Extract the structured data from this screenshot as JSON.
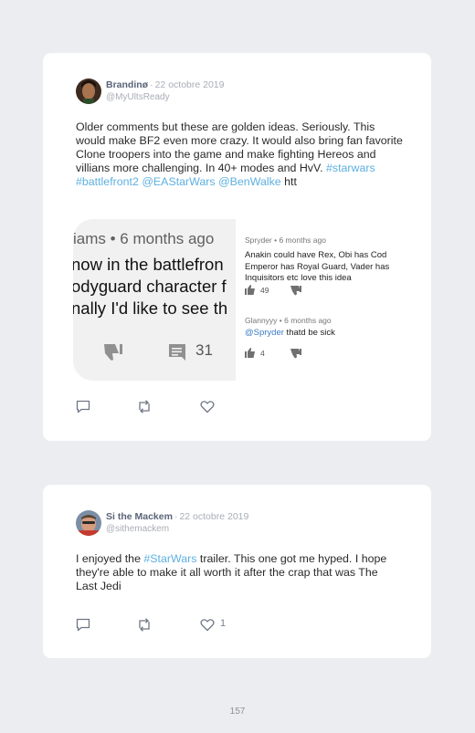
{
  "tweets": [
    {
      "name": "Brandinø",
      "separator": "·",
      "date": "22 octobre 2019",
      "handle": "@MyUltsReady",
      "body": [
        {
          "t": "text",
          "v": "Older comments but these are golden ideas. Seriously. This would make BF2 even more crazy. It would also bring fan favorite Clone troopers into the game and make fighting Hereos and villians more challenging. In 40+ modes and HvV. "
        },
        {
          "t": "tag",
          "v": "#starwars"
        },
        {
          "t": "text",
          "v": " "
        },
        {
          "t": "tag",
          "v": "#battlefront2"
        },
        {
          "t": "text",
          "v": " "
        },
        {
          "t": "tag",
          "v": "@EAStarWars"
        },
        {
          "t": "text",
          "v": " "
        },
        {
          "t": "tag",
          "v": "@BenWalke"
        },
        {
          "t": "text",
          "v": " htt"
        }
      ],
      "embed": {
        "left": {
          "meta": "iams • 6 months ago",
          "lines": [
            "now in the battlefron",
            "odyguard character f",
            "nally I'd like to see th"
          ],
          "comment_count": "31"
        },
        "right": [
          {
            "meta": "Spryder • 6 months ago",
            "lines": [
              "Anakin could have Rex, Obi has Cod",
              "Emperor has Royal Guard, Vader has",
              "Inquisitors etc love this idea"
            ],
            "likes": "49"
          },
          {
            "meta": "Glannyyy • 6 months ago",
            "mention": "@Spryder",
            "text": " thatd be sick",
            "likes": "4"
          }
        ]
      },
      "like_count": ""
    },
    {
      "name": "Si the Mackem",
      "separator": "·",
      "date": "22 octobre 2019",
      "handle": "@sithemackem",
      "body": [
        {
          "t": "text",
          "v": "I enjoyed the "
        },
        {
          "t": "tag",
          "v": "#StarWars"
        },
        {
          "t": "text",
          "v": " trailer. This one got me hyped. I hope they're able to make it all worth it after the crap that was The Last Jedi"
        }
      ],
      "like_count": "1"
    }
  ],
  "page_number": "157",
  "colors": {
    "background": "#ecedf1",
    "card": "#ffffff",
    "link": "#5db0e0",
    "muted": "#a9adb6",
    "name": "#5a6377"
  },
  "icons": [
    "comment-icon",
    "retweet-icon",
    "heart-icon",
    "thumbs-up-icon",
    "thumbs-down-icon"
  ]
}
